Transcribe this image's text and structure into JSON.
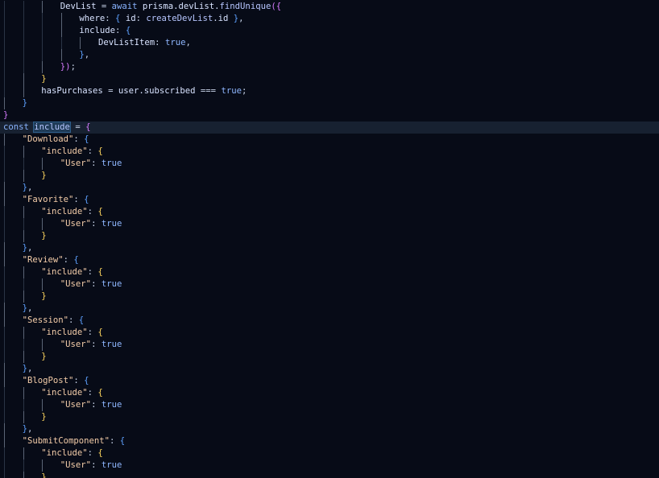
{
  "editor": {
    "theme_colors": {
      "background": "#070b17",
      "current_line": "#172131",
      "plain": "#c7d3e8",
      "keyword": "#8ab4ff",
      "function": "#b7c6ff",
      "string": "#f4cda9",
      "property": "#d8e3ff",
      "bracket_yellow": "#ffd75f",
      "bracket_purple": "#d77cff",
      "bracket_blue": "#5ea1ff",
      "boolean": "#8fb7ff"
    },
    "current_line_index": 10,
    "code_lines": [
      {
        "indent": 3,
        "guides": [
          0,
          1,
          2
        ],
        "tokens": [
          {
            "text": "DevList",
            "color": "#d8e3ff"
          },
          {
            "text": " = ",
            "color": "#c7d3e8"
          },
          {
            "text": "await",
            "color": "#8ab4ff"
          },
          {
            "text": " prisma.devList.",
            "color": "#d8e3ff"
          },
          {
            "text": "findUnique",
            "color": "#b7c6ff"
          },
          {
            "text": "({",
            "color": "#d77cff"
          }
        ]
      },
      {
        "indent": 4,
        "guides": [
          0,
          1,
          2,
          3
        ],
        "tokens": [
          {
            "text": "where",
            "color": "#d8e3ff"
          },
          {
            "text": ": ",
            "color": "#c7d3e8"
          },
          {
            "text": "{",
            "color": "#5ea1ff"
          },
          {
            "text": " id",
            "color": "#d8e3ff"
          },
          {
            "text": ": ",
            "color": "#c7d3e8"
          },
          {
            "text": "createDevList",
            "color": "#b7c6ff"
          },
          {
            "text": ".id ",
            "color": "#d8e3ff"
          },
          {
            "text": "}",
            "color": "#5ea1ff"
          },
          {
            "text": ",",
            "color": "#c7d3e8"
          }
        ]
      },
      {
        "indent": 4,
        "guides": [
          0,
          1,
          2,
          3
        ],
        "tokens": [
          {
            "text": "include",
            "color": "#d8e3ff"
          },
          {
            "text": ": ",
            "color": "#c7d3e8"
          },
          {
            "text": "{",
            "color": "#5ea1ff"
          }
        ]
      },
      {
        "indent": 5,
        "guides": [
          0,
          1,
          2,
          3,
          4
        ],
        "tokens": [
          {
            "text": "DevListItem",
            "color": "#d8e3ff"
          },
          {
            "text": ": ",
            "color": "#c7d3e8"
          },
          {
            "text": "true",
            "color": "#8fb7ff"
          },
          {
            "text": ",",
            "color": "#c7d3e8"
          }
        ]
      },
      {
        "indent": 4,
        "guides": [
          0,
          1,
          2,
          3
        ],
        "tokens": [
          {
            "text": "}",
            "color": "#5ea1ff"
          },
          {
            "text": ",",
            "color": "#c7d3e8"
          }
        ]
      },
      {
        "indent": 3,
        "guides": [
          0,
          1,
          2
        ],
        "tokens": [
          {
            "text": "})",
            "color": "#d77cff"
          },
          {
            "text": ";",
            "color": "#c7d3e8"
          }
        ]
      },
      {
        "indent": 2,
        "guides": [
          0,
          1
        ],
        "tokens": [
          {
            "text": "}",
            "color": "#ffd75f"
          }
        ]
      },
      {
        "indent": 2,
        "guides": [
          0,
          1
        ],
        "tokens": [
          {
            "text": "hasPurchases",
            "color": "#d8e3ff"
          },
          {
            "text": " = ",
            "color": "#c7d3e8"
          },
          {
            "text": "user.subscribed",
            "color": "#d8e3ff"
          },
          {
            "text": " === ",
            "color": "#c7d3e8"
          },
          {
            "text": "true",
            "color": "#8fb7ff"
          },
          {
            "text": ";",
            "color": "#c7d3e8"
          }
        ]
      },
      {
        "indent": 1,
        "guides": [
          0
        ],
        "tokens": [
          {
            "text": "}",
            "color": "#5ea1ff"
          }
        ]
      },
      {
        "indent": 0,
        "guides": [],
        "tokens": [
          {
            "text": "}",
            "color": "#d77cff"
          }
        ]
      },
      {
        "indent": 0,
        "guides": [],
        "tokens": [
          {
            "text": "const",
            "color": "#8ab4ff"
          },
          {
            "text": " ",
            "color": "#c7d3e8"
          },
          {
            "text": "include",
            "color": "#b7c6ff",
            "highlight": true
          },
          {
            "text": " = ",
            "color": "#c7d3e8"
          },
          {
            "text": "{",
            "color": "#d77cff"
          }
        ]
      },
      {
        "indent": 1,
        "guides": [
          0
        ],
        "tokens": [
          {
            "text": "\"Download\"",
            "color": "#f4cda9"
          },
          {
            "text": ": ",
            "color": "#c7d3e8"
          },
          {
            "text": "{",
            "color": "#5ea1ff"
          }
        ]
      },
      {
        "indent": 2,
        "guides": [
          0,
          1
        ],
        "tokens": [
          {
            "text": "\"include\"",
            "color": "#f4cda9"
          },
          {
            "text": ": ",
            "color": "#c7d3e8"
          },
          {
            "text": "{",
            "color": "#ffd75f"
          }
        ]
      },
      {
        "indent": 3,
        "guides": [
          0,
          1,
          2
        ],
        "tokens": [
          {
            "text": "\"User\"",
            "color": "#f4cda9"
          },
          {
            "text": ": ",
            "color": "#c7d3e8"
          },
          {
            "text": "true",
            "color": "#8fb7ff"
          }
        ]
      },
      {
        "indent": 2,
        "guides": [
          0,
          1
        ],
        "tokens": [
          {
            "text": "}",
            "color": "#ffd75f"
          }
        ]
      },
      {
        "indent": 1,
        "guides": [
          0
        ],
        "tokens": [
          {
            "text": "}",
            "color": "#5ea1ff"
          },
          {
            "text": ",",
            "color": "#c7d3e8"
          }
        ]
      },
      {
        "indent": 1,
        "guides": [
          0
        ],
        "tokens": [
          {
            "text": "\"Favorite\"",
            "color": "#f4cda9"
          },
          {
            "text": ": ",
            "color": "#c7d3e8"
          },
          {
            "text": "{",
            "color": "#5ea1ff"
          }
        ]
      },
      {
        "indent": 2,
        "guides": [
          0,
          1
        ],
        "tokens": [
          {
            "text": "\"include\"",
            "color": "#f4cda9"
          },
          {
            "text": ": ",
            "color": "#c7d3e8"
          },
          {
            "text": "{",
            "color": "#ffd75f"
          }
        ]
      },
      {
        "indent": 3,
        "guides": [
          0,
          1,
          2
        ],
        "tokens": [
          {
            "text": "\"User\"",
            "color": "#f4cda9"
          },
          {
            "text": ": ",
            "color": "#c7d3e8"
          },
          {
            "text": "true",
            "color": "#8fb7ff"
          }
        ]
      },
      {
        "indent": 2,
        "guides": [
          0,
          1
        ],
        "tokens": [
          {
            "text": "}",
            "color": "#ffd75f"
          }
        ]
      },
      {
        "indent": 1,
        "guides": [
          0
        ],
        "tokens": [
          {
            "text": "}",
            "color": "#5ea1ff"
          },
          {
            "text": ",",
            "color": "#c7d3e8"
          }
        ]
      },
      {
        "indent": 1,
        "guides": [
          0
        ],
        "tokens": [
          {
            "text": "\"Review\"",
            "color": "#f4cda9"
          },
          {
            "text": ": ",
            "color": "#c7d3e8"
          },
          {
            "text": "{",
            "color": "#5ea1ff"
          }
        ]
      },
      {
        "indent": 2,
        "guides": [
          0,
          1
        ],
        "tokens": [
          {
            "text": "\"include\"",
            "color": "#f4cda9"
          },
          {
            "text": ": ",
            "color": "#c7d3e8"
          },
          {
            "text": "{",
            "color": "#ffd75f"
          }
        ]
      },
      {
        "indent": 3,
        "guides": [
          0,
          1,
          2
        ],
        "tokens": [
          {
            "text": "\"User\"",
            "color": "#f4cda9"
          },
          {
            "text": ": ",
            "color": "#c7d3e8"
          },
          {
            "text": "true",
            "color": "#8fb7ff"
          }
        ]
      },
      {
        "indent": 2,
        "guides": [
          0,
          1
        ],
        "tokens": [
          {
            "text": "}",
            "color": "#ffd75f"
          }
        ]
      },
      {
        "indent": 1,
        "guides": [
          0
        ],
        "tokens": [
          {
            "text": "}",
            "color": "#5ea1ff"
          },
          {
            "text": ",",
            "color": "#c7d3e8"
          }
        ]
      },
      {
        "indent": 1,
        "guides": [
          0
        ],
        "tokens": [
          {
            "text": "\"Session\"",
            "color": "#f4cda9"
          },
          {
            "text": ": ",
            "color": "#c7d3e8"
          },
          {
            "text": "{",
            "color": "#5ea1ff"
          }
        ]
      },
      {
        "indent": 2,
        "guides": [
          0,
          1
        ],
        "tokens": [
          {
            "text": "\"include\"",
            "color": "#f4cda9"
          },
          {
            "text": ": ",
            "color": "#c7d3e8"
          },
          {
            "text": "{",
            "color": "#ffd75f"
          }
        ]
      },
      {
        "indent": 3,
        "guides": [
          0,
          1,
          2
        ],
        "tokens": [
          {
            "text": "\"User\"",
            "color": "#f4cda9"
          },
          {
            "text": ": ",
            "color": "#c7d3e8"
          },
          {
            "text": "true",
            "color": "#8fb7ff"
          }
        ]
      },
      {
        "indent": 2,
        "guides": [
          0,
          1
        ],
        "tokens": [
          {
            "text": "}",
            "color": "#ffd75f"
          }
        ]
      },
      {
        "indent": 1,
        "guides": [
          0
        ],
        "tokens": [
          {
            "text": "}",
            "color": "#5ea1ff"
          },
          {
            "text": ",",
            "color": "#c7d3e8"
          }
        ]
      },
      {
        "indent": 1,
        "guides": [
          0
        ],
        "tokens": [
          {
            "text": "\"BlogPost\"",
            "color": "#f4cda9"
          },
          {
            "text": ": ",
            "color": "#c7d3e8"
          },
          {
            "text": "{",
            "color": "#5ea1ff"
          }
        ]
      },
      {
        "indent": 2,
        "guides": [
          0,
          1
        ],
        "tokens": [
          {
            "text": "\"include\"",
            "color": "#f4cda9"
          },
          {
            "text": ": ",
            "color": "#c7d3e8"
          },
          {
            "text": "{",
            "color": "#ffd75f"
          }
        ]
      },
      {
        "indent": 3,
        "guides": [
          0,
          1,
          2
        ],
        "tokens": [
          {
            "text": "\"User\"",
            "color": "#f4cda9"
          },
          {
            "text": ": ",
            "color": "#c7d3e8"
          },
          {
            "text": "true",
            "color": "#8fb7ff"
          }
        ]
      },
      {
        "indent": 2,
        "guides": [
          0,
          1
        ],
        "tokens": [
          {
            "text": "}",
            "color": "#ffd75f"
          }
        ]
      },
      {
        "indent": 1,
        "guides": [
          0
        ],
        "tokens": [
          {
            "text": "}",
            "color": "#5ea1ff"
          },
          {
            "text": ",",
            "color": "#c7d3e8"
          }
        ]
      },
      {
        "indent": 1,
        "guides": [
          0
        ],
        "tokens": [
          {
            "text": "\"SubmitComponent\"",
            "color": "#f4cda9"
          },
          {
            "text": ": ",
            "color": "#c7d3e8"
          },
          {
            "text": "{",
            "color": "#5ea1ff"
          }
        ]
      },
      {
        "indent": 2,
        "guides": [
          0,
          1
        ],
        "tokens": [
          {
            "text": "\"include\"",
            "color": "#f4cda9"
          },
          {
            "text": ": ",
            "color": "#c7d3e8"
          },
          {
            "text": "{",
            "color": "#ffd75f"
          }
        ]
      },
      {
        "indent": 3,
        "guides": [
          0,
          1,
          2
        ],
        "tokens": [
          {
            "text": "\"User\"",
            "color": "#f4cda9"
          },
          {
            "text": ": ",
            "color": "#c7d3e8"
          },
          {
            "text": "true",
            "color": "#8fb7ff"
          }
        ]
      },
      {
        "indent": 2,
        "guides": [
          0,
          1
        ],
        "tokens": [
          {
            "text": "}",
            "color": "#ffd75f"
          }
        ]
      }
    ]
  }
}
